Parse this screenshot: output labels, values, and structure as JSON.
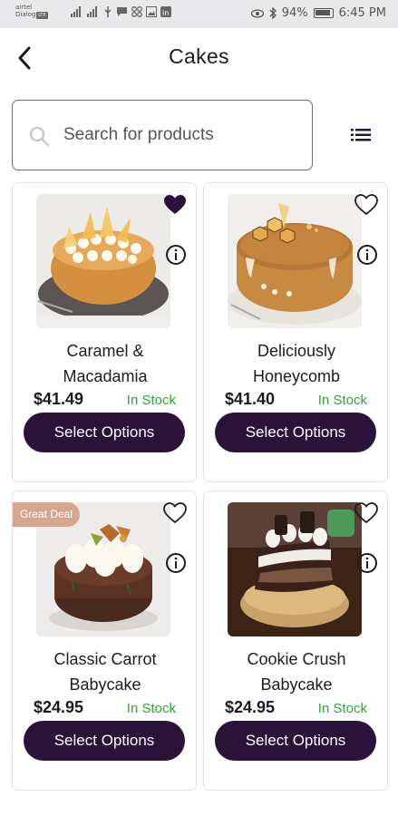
{
  "status_bar": {
    "carrier_line1": "airtel",
    "carrier_line2": "Dialog",
    "carrier_badge": "LTE",
    "battery": "94%",
    "time": "6:45 PM"
  },
  "header": {
    "title": "Cakes"
  },
  "search": {
    "placeholder": "Search for products",
    "value": ""
  },
  "products": [
    {
      "name_line1": "Caramel &",
      "name_line2": "Macadamia",
      "price": "$41.49",
      "stock": "In Stock",
      "button": "Select Options",
      "favorited": true,
      "badge": ""
    },
    {
      "name_line1": "Deliciously",
      "name_line2": "Honeycomb",
      "price": "$41.40",
      "stock": "In Stock",
      "button": "Select Options",
      "favorited": false,
      "badge": ""
    },
    {
      "name_line1": "Classic Carrot",
      "name_line2": "Babycake",
      "price": "$24.95",
      "stock": "In Stock",
      "button": "Select Options",
      "favorited": false,
      "badge": "Great Deal"
    },
    {
      "name_line1": "Cookie Crush",
      "name_line2": "Babycake",
      "price": "$24.95",
      "stock": "In Stock",
      "button": "Select Options",
      "favorited": false,
      "badge": ""
    }
  ],
  "colors": {
    "accent": "#2a1238",
    "in_stock": "#2ea534",
    "deal_badge": "#d6a78f"
  },
  "icons": {
    "back": "arrow-left-icon",
    "search": "search-icon",
    "list_view": "list-icon",
    "favorite": "heart-icon",
    "info": "info-icon"
  }
}
